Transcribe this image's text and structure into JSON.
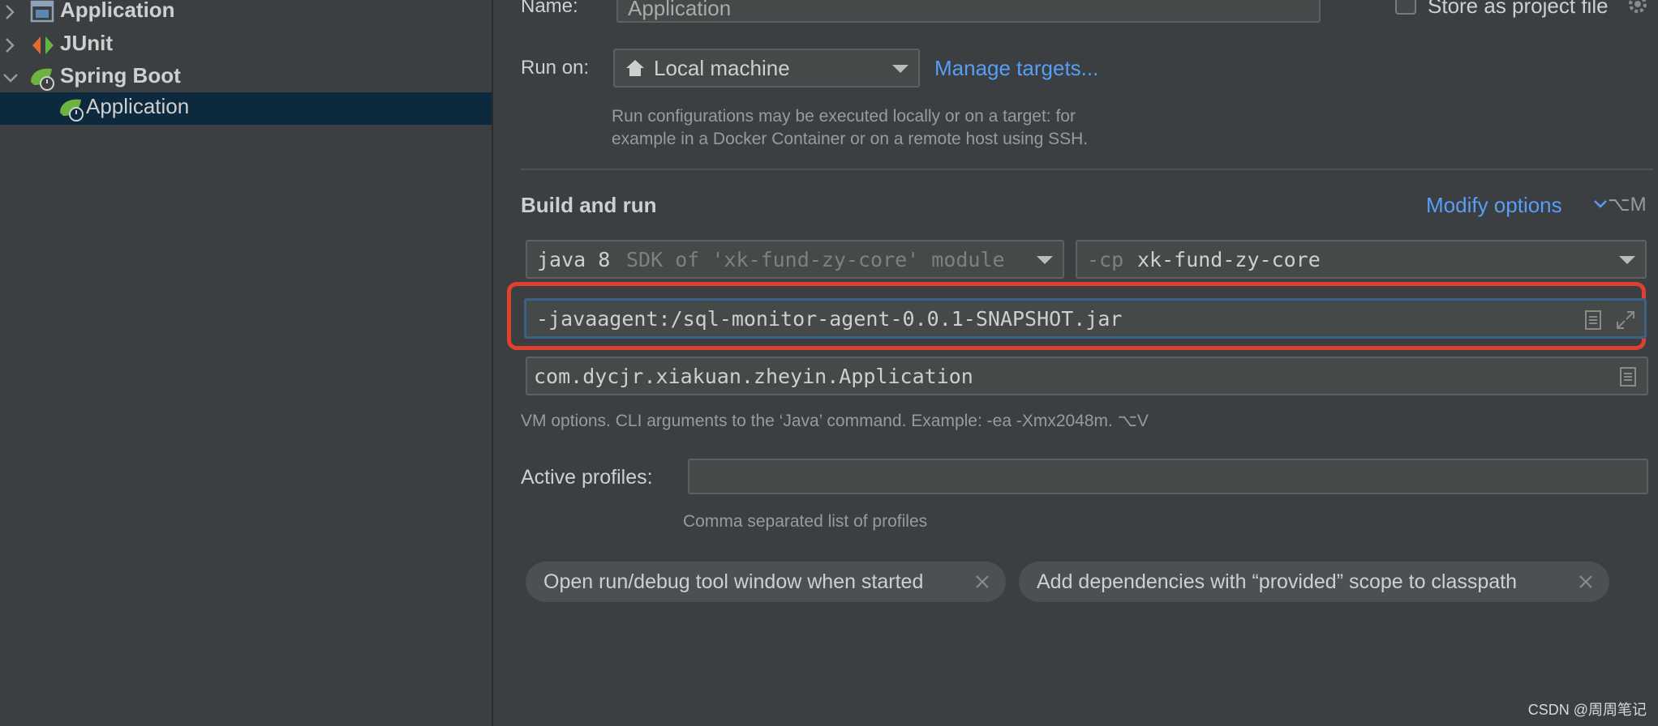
{
  "tree": {
    "items": [
      {
        "label": "Application",
        "icon": "application-config-icon"
      },
      {
        "label": "JUnit",
        "icon": "junit-icon"
      },
      {
        "label": "Spring Boot",
        "icon": "spring-boot-icon"
      },
      {
        "label": "Application",
        "icon": "spring-boot-app-icon"
      }
    ]
  },
  "form": {
    "name_label": "Name:",
    "name_value": "Application",
    "store_as_project_file": "Store as project file",
    "run_on_label": "Run on:",
    "run_on_value": "Local machine",
    "manage_targets": "Manage targets...",
    "run_on_hint_line1": "Run configurations may be executed locally or on a target: for",
    "run_on_hint_line2": "example in a Docker Container or on a remote host using SSH.",
    "build_and_run": "Build and run",
    "modify_options": "Modify options",
    "modify_options_shortcut": "⌥M",
    "jdk_main": "java 8",
    "jdk_detail": "SDK of 'xk-fund-zy-core' module",
    "cp_prefix": "-cp",
    "cp_module": "xk-fund-zy-core",
    "vm_options_value": "-javaagent:/sql-monitor-agent-0.0.1-SNAPSHOT.jar",
    "main_class_value": "com.dycjr.xiakuan.zheyin.Application",
    "vm_options_hint": "VM options. CLI arguments to the ‘Java’ command. Example: -ea -Xmx2048m. ⌥V",
    "active_profiles_label": "Active profiles:",
    "active_profiles_value": "",
    "active_profiles_hint": "Comma separated list of profiles",
    "chip_1": "Open run/debug tool window when started",
    "chip_2": "Add dependencies with “provided” scope to classpath"
  },
  "watermark": "CSDN @周周笔记",
  "colors": {
    "background": "#3c3f41",
    "selection": "#0d293e",
    "link": "#589df6",
    "highlight_outline": "#e0412f",
    "focus_border": "#3d6185"
  }
}
